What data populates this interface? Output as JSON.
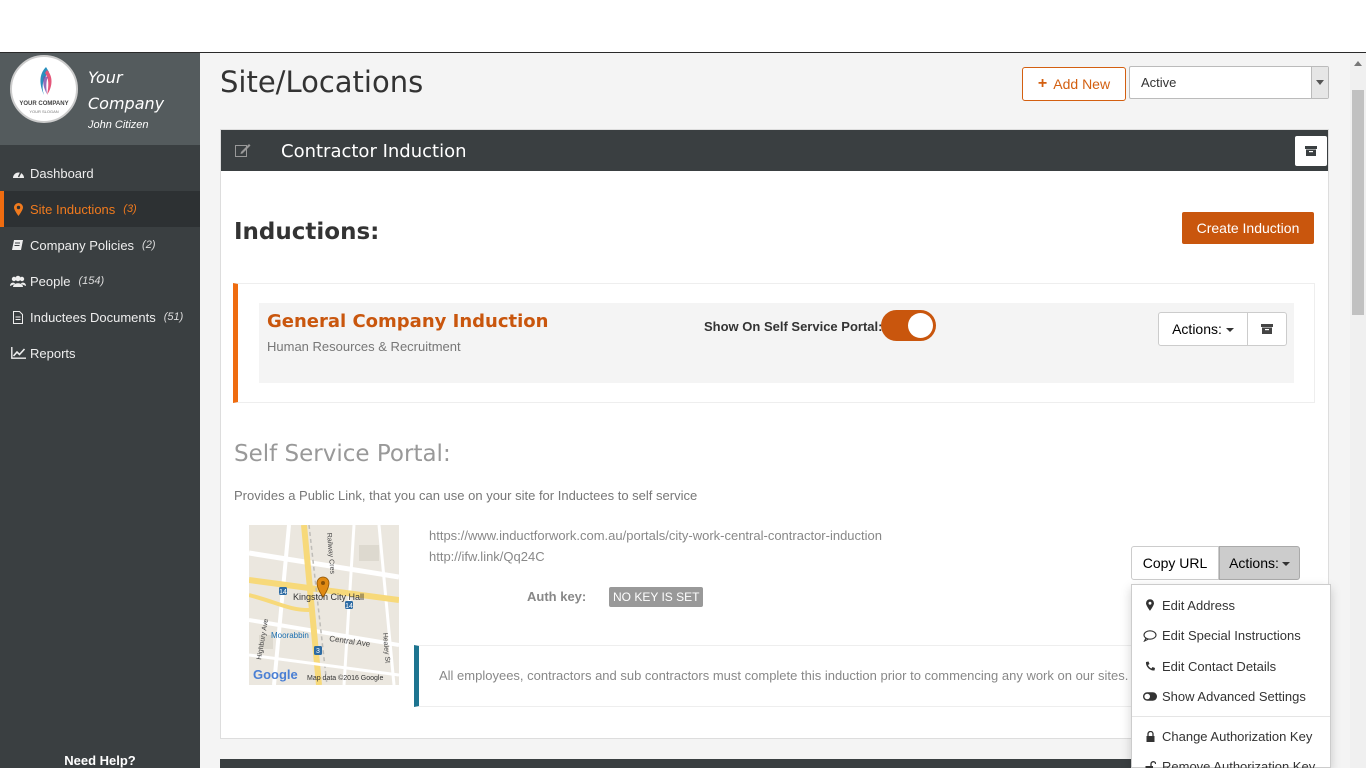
{
  "brand": {
    "logo_text": "YOUR COMPANY",
    "logo_tagline": "YOUR SLOGAN",
    "name_line1": "Your",
    "name_line2": "Company",
    "user": "John Citizen"
  },
  "sidebar": {
    "items": [
      {
        "label": "Dashboard",
        "count": "",
        "icon": "dashboard-icon"
      },
      {
        "label": "Site Inductions",
        "count": "(3)",
        "icon": "map-marker-icon"
      },
      {
        "label": "Company Policies",
        "count": "(2)",
        "icon": "book-icon"
      },
      {
        "label": "People",
        "count": "(154)",
        "icon": "users-icon"
      },
      {
        "label": "Inductees Documents",
        "count": "(51)",
        "icon": "document-icon"
      },
      {
        "label": "Reports",
        "count": "",
        "icon": "line-chart-icon"
      }
    ],
    "help": "Need Help?"
  },
  "header": {
    "title": "Site/Locations",
    "add_new": "Add New",
    "status_value": "Active"
  },
  "card": {
    "title": "Contractor Induction",
    "inductions_heading": "Inductions:",
    "create_button": "Create Induction",
    "induction": {
      "name": "General Company Induction",
      "department": "Human Resources & Recruitment",
      "portal_label": "Show On Self Service Portal:",
      "portal_enabled": true,
      "actions_label": "Actions:"
    },
    "self_service": {
      "heading": "Self Service Portal:",
      "description": "Provides a Public Link, that you can use on your site for Inductees to self service",
      "url_long": "https://www.inductforwork.com.au/portals/city-work-central-contractor-induction",
      "url_short": "http://ifw.link/Qq24C",
      "auth_label": "Auth key:",
      "auth_value": "NO KEY IS SET",
      "copy_url": "Copy URL",
      "actions_label": "Actions:",
      "note": "All employees, contractors and sub contractors must complete this induction prior to commencing any work on our sites."
    },
    "map": {
      "labels": [
        "Kingston City Hall",
        "Moorabbin",
        "Central Ave",
        "Highbury Ave",
        "Railway Cres",
        "Healey St"
      ],
      "shields": [
        "14",
        "14",
        "3"
      ],
      "attribution": "Map data ©2016 Google",
      "google": "Google"
    }
  },
  "dropdown": {
    "items": [
      {
        "label": "Edit Address",
        "icon": "map-marker-icon"
      },
      {
        "label": "Edit Special Instructions",
        "icon": "comment-icon"
      },
      {
        "label": "Edit Contact Details",
        "icon": "phone-icon"
      },
      {
        "label": "Show Advanced Settings",
        "icon": "toggle-icon"
      },
      {
        "label": "Change Authorization Key",
        "icon": "lock-icon"
      },
      {
        "label": "Remove Authorization Key",
        "icon": "unlock-icon"
      }
    ]
  },
  "colors": {
    "accent": "#c9560d",
    "sidebar_bg": "#3a3f41",
    "note_border": "#1d7490"
  }
}
